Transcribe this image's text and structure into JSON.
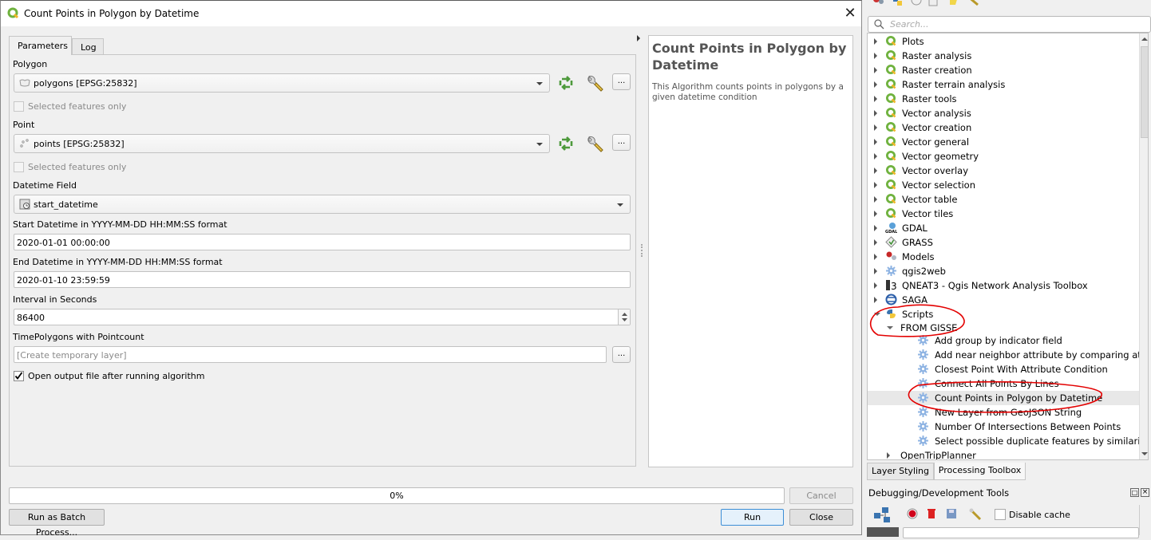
{
  "dialog": {
    "title": "Count Points in Polygon by Datetime",
    "tabs": [
      {
        "label": "Parameters",
        "active": true
      },
      {
        "label": "Log",
        "active": false
      }
    ],
    "params": {
      "polygon": {
        "label": "Polygon",
        "value": "polygons [EPSG:25832]",
        "selected_only_label": "Selected features only",
        "selected_only": false
      },
      "point": {
        "label": "Point",
        "value": "points [EPSG:25832]",
        "selected_only_label": "Selected features only",
        "selected_only": false
      },
      "datetime_field": {
        "label": "Datetime Field",
        "value": "start_datetime"
      },
      "start_datetime": {
        "label": "Start Datetime in YYYY-MM-DD HH:MM:SS format",
        "value": "2020-01-01 00:00:00"
      },
      "end_datetime": {
        "label": "End Datetime in YYYY-MM-DD HH:MM:SS format",
        "value": "2020-01-10 23:59:59"
      },
      "interval": {
        "label": "Interval in Seconds",
        "value": "86400"
      },
      "output": {
        "label": "TimePolygons with Pointcount",
        "placeholder": "[Create temporary layer]"
      },
      "open_output": {
        "label": "Open output file after running algorithm",
        "checked": true
      }
    },
    "help": {
      "title": "Count Points in Polygon by Datetime",
      "description": "This Algorithm counts points in polygons by a given datetime condition"
    },
    "progress": {
      "percent": 0,
      "label": "0%"
    },
    "buttons": {
      "cancel": "Cancel",
      "run": "Run",
      "close": "Close",
      "batch": "Run as Batch Process..."
    },
    "close_glyph": "✕",
    "dots_glyph": "..."
  },
  "toolbox": {
    "search_placeholder": "Search...",
    "tree": [
      {
        "label": "Plots",
        "icon": "qgis-icon",
        "level": 0,
        "expanded": false
      },
      {
        "label": "Raster analysis",
        "icon": "qgis-icon",
        "level": 0,
        "expanded": false
      },
      {
        "label": "Raster creation",
        "icon": "qgis-icon",
        "level": 0,
        "expanded": false
      },
      {
        "label": "Raster terrain analysis",
        "icon": "qgis-icon",
        "level": 0,
        "expanded": false
      },
      {
        "label": "Raster tools",
        "icon": "qgis-icon",
        "level": 0,
        "expanded": false
      },
      {
        "label": "Vector analysis",
        "icon": "qgis-icon",
        "level": 0,
        "expanded": false
      },
      {
        "label": "Vector creation",
        "icon": "qgis-icon",
        "level": 0,
        "expanded": false
      },
      {
        "label": "Vector general",
        "icon": "qgis-icon",
        "level": 0,
        "expanded": false
      },
      {
        "label": "Vector geometry",
        "icon": "qgis-icon",
        "level": 0,
        "expanded": false
      },
      {
        "label": "Vector overlay",
        "icon": "qgis-icon",
        "level": 0,
        "expanded": false
      },
      {
        "label": "Vector selection",
        "icon": "qgis-icon",
        "level": 0,
        "expanded": false
      },
      {
        "label": "Vector table",
        "icon": "qgis-icon",
        "level": 0,
        "expanded": false
      },
      {
        "label": "Vector tiles",
        "icon": "qgis-icon",
        "level": 0,
        "expanded": false
      },
      {
        "label": "GDAL",
        "icon": "gdal-icon",
        "level": 0,
        "expanded": false
      },
      {
        "label": "GRASS",
        "icon": "grass-icon",
        "level": 0,
        "expanded": false
      },
      {
        "label": "Models",
        "icon": "models-icon",
        "level": 0,
        "expanded": false
      },
      {
        "label": "qgis2web",
        "icon": "gear-icon",
        "level": 0,
        "expanded": false
      },
      {
        "label": "QNEAT3 - Qgis Network Analysis Toolbox",
        "icon": "qneat3-icon",
        "level": 0,
        "expanded": false
      },
      {
        "label": "SAGA",
        "icon": "saga-icon",
        "level": 0,
        "expanded": false
      },
      {
        "label": "Scripts",
        "icon": "python-icon",
        "level": 0,
        "expanded": true
      },
      {
        "label": "FROM GISSE",
        "icon": "",
        "level": 1,
        "expanded": true
      },
      {
        "label": "Add group by indicator field",
        "icon": "gear-icon",
        "level": 2
      },
      {
        "label": "Add near neighbor attribute by comparing att...",
        "icon": "gear-icon",
        "level": 2
      },
      {
        "label": "Closest Point With Attribute Condition",
        "icon": "gear-icon",
        "level": 2
      },
      {
        "label": "Connect All Points By Lines",
        "icon": "gear-icon",
        "level": 2
      },
      {
        "label": "Count Points in Polygon by Datetime",
        "icon": "gear-icon",
        "level": 2,
        "selected": true
      },
      {
        "label": "New Layer from GeoJSON String",
        "icon": "gear-icon",
        "level": 2
      },
      {
        "label": "Number Of Intersections Between Points",
        "icon": "gear-icon",
        "level": 2
      },
      {
        "label": "Select possible duplicate features by similarity ...",
        "icon": "gear-icon",
        "level": 2
      },
      {
        "label": "OpenTripPlanner",
        "icon": "",
        "level": 1,
        "expanded": false
      }
    ],
    "bottom_tabs": [
      {
        "label": "Layer Styling",
        "active": false
      },
      {
        "label": "Processing Toolbox",
        "active": true
      }
    ],
    "debug": {
      "title": "Debugging/Development Tools",
      "disable_cache_label": "Disable cache",
      "disable_cache": false
    }
  }
}
